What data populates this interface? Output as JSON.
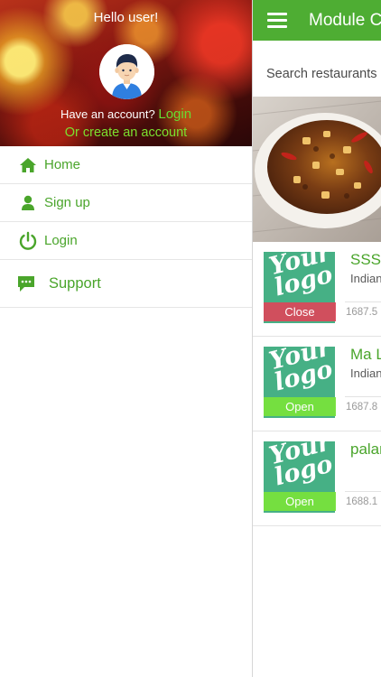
{
  "drawer": {
    "greeting": "Hello user!",
    "have_account": "Have an account?",
    "login_link": "Login",
    "create_account": "Or create an account",
    "menu": [
      {
        "label": "Home",
        "icon": "home-icon"
      },
      {
        "label": "Sign up",
        "icon": "user-icon"
      },
      {
        "label": "Login",
        "icon": "power-icon"
      },
      {
        "label": "Support",
        "icon": "chat-icon"
      }
    ]
  },
  "main": {
    "title": "Module C",
    "search_placeholder": "Search restaurants",
    "restaurants": [
      {
        "name": "SSS",
        "cuisine": "Indian",
        "distance": "1687.5",
        "status": "Close",
        "logo_text": "Your logo"
      },
      {
        "name": "Ma L",
        "cuisine": "Indian",
        "distance": "1687.8",
        "status": "Open",
        "logo_text": "Your logo"
      },
      {
        "name": "palar",
        "cuisine": "",
        "distance": "1688.1",
        "status": "Open",
        "logo_text": "Your logo"
      }
    ]
  },
  "colors": {
    "brand_green": "#4ead33",
    "link_green": "#66dd33",
    "logo_teal": "#46b085",
    "closed_red": "#dc465a",
    "open_green": "#78e13c"
  }
}
